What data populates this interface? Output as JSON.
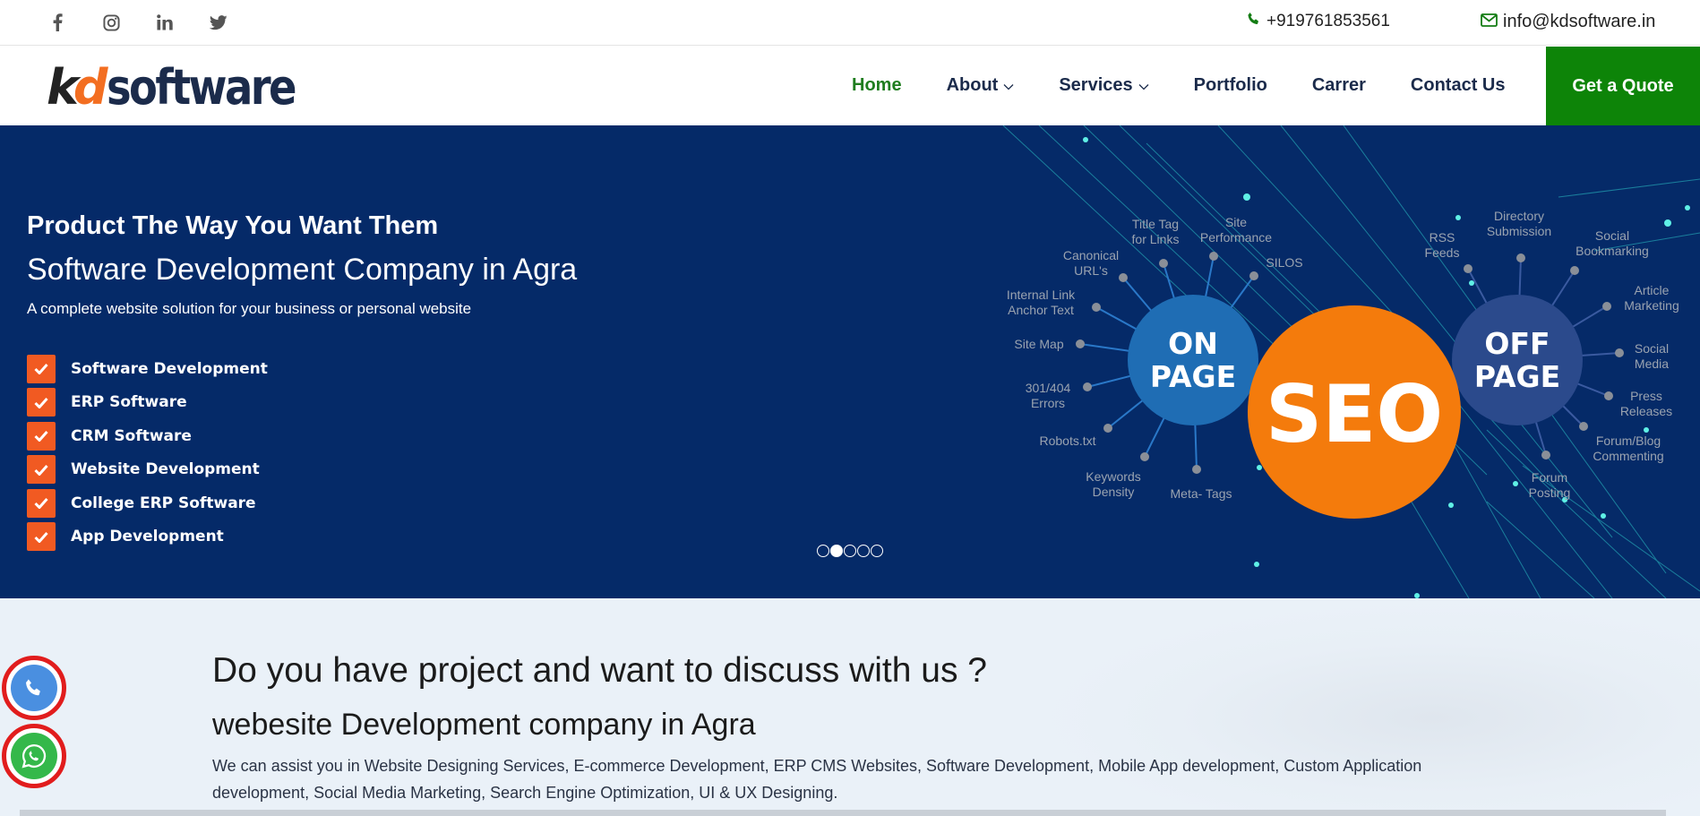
{
  "topbar": {
    "social": [
      "facebook-icon",
      "instagram-icon",
      "linkedin-icon",
      "twitter-icon"
    ],
    "phone": "+919761853561",
    "email": "info@kdsoftware.in"
  },
  "header": {
    "logo_kd": "kd",
    "logo_software": "software",
    "nav": [
      {
        "label": "Home",
        "active": true
      },
      {
        "label": "About",
        "dropdown": true
      },
      {
        "label": "Services",
        "dropdown": true
      },
      {
        "label": "Portfolio"
      },
      {
        "label": "Carrer"
      },
      {
        "label": "Contact Us"
      }
    ],
    "quote_label": "Get a Quote"
  },
  "hero": {
    "title": "Product The Way You Want Them",
    "subtitle": "Software Development Company in Agra",
    "tagline": "A complete website solution for your business or personal website",
    "items": [
      "Software Development",
      "ERP Software",
      "CRM Software",
      "Website Development",
      "College ERP Software",
      "App Development"
    ],
    "slides": 5,
    "active_slide": 2,
    "seo_graphic": {
      "center": "SEO",
      "left_circle": [
        "ON",
        "PAGE"
      ],
      "right_circle": [
        "OFF",
        "PAGE"
      ],
      "on_page_labels": [
        "Title Tag for Links",
        "Site Performance",
        "Canonical URL's",
        "SILOS",
        "Internal Link Anchor Text",
        "Site Map",
        "301/404 Errors",
        "Robots.txt",
        "Keywords Density",
        "Meta- Tags"
      ],
      "off_page_labels": [
        "Directory Submission",
        "RSS Feeds",
        "Social Bookmarking",
        "Article Marketing",
        "Social Media",
        "Press Releases",
        "Forum/Blog Commenting",
        "Forum Posting"
      ]
    }
  },
  "cta": {
    "heading": "Do you have project and want to discuss with us ?",
    "subheading": "webesite Development company in Agra",
    "body": "We can assist you in Website Designing Services, E-commerce Development, ERP CMS Websites, Software Development, Mobile App development, Custom Application development, Social Media Marketing, Search Engine Optimization, UI & UX Designing."
  },
  "colors": {
    "navy": "#052a68",
    "green": "#0d8408",
    "orange": "#f15a22",
    "seo_orange": "#f47b0c",
    "on_page_blue": "#1f6db4",
    "off_page_blue": "#2b4a8c"
  }
}
